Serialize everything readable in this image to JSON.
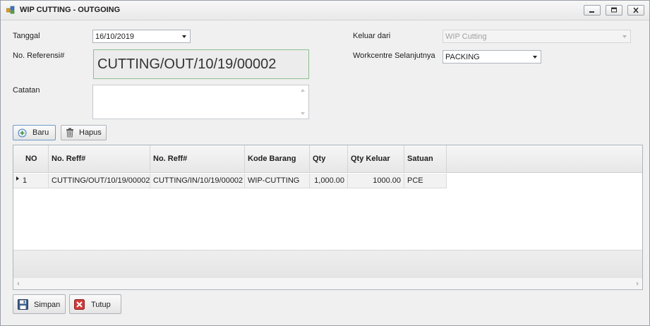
{
  "window": {
    "title": "WIP CUTTING - OUTGOING"
  },
  "form": {
    "tanggal_label": "Tanggal",
    "tanggal_value": "16/10/2019",
    "no_ref_label": "No. Referensi#",
    "no_ref_value": "CUTTING/OUT/10/19/00002",
    "catatan_label": "Catatan",
    "catatan_value": "",
    "keluar_dari_label": "Keluar dari",
    "keluar_dari_value": "WIP Cutting",
    "workcentre_label": "Workcentre Selanjutnya",
    "workcentre_value": "PACKING"
  },
  "toolbar": {
    "baru_label": "Baru",
    "hapus_label": "Hapus"
  },
  "grid": {
    "columns": [
      "NO",
      "No. Reff#",
      "No. Reff#",
      "Kode Barang",
      "Qty",
      "Qty Keluar",
      "Satuan"
    ],
    "rows": [
      {
        "no": "1",
        "no_reff_out": "CUTTING/OUT/10/19/00002",
        "no_reff_in": "CUTTING/IN/10/19/00002",
        "kode_barang": "WIP-CUTTING",
        "qty": "1,000.00",
        "qty_keluar": "1000.00",
        "satuan": "PCE"
      }
    ]
  },
  "actions": {
    "simpan_label": "Simpan",
    "tutup_label": "Tutup"
  },
  "colors": {
    "ref_border": "#8fbf8f",
    "focus_border": "#6d9ac8",
    "close_red": "#d23a3a"
  }
}
